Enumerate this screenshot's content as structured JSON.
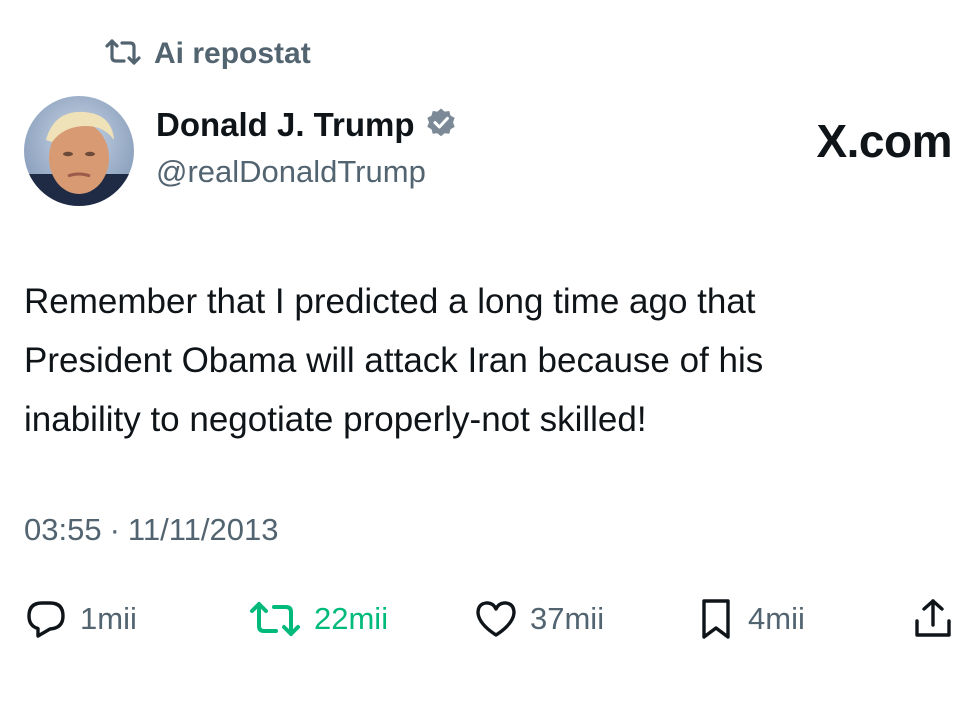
{
  "repost_header": {
    "icon": "repost-icon",
    "label": "Ai repostat"
  },
  "author": {
    "name": "Donald J. Trump",
    "handle": "@realDonaldTrump",
    "verified_icon": "verified-badge-icon",
    "verified_color": "#7b8a96"
  },
  "brand": {
    "label": "X.com"
  },
  "tweet": {
    "lines": [
      "Remember that I predicted a long time ago that",
      "President Obama will attack Iran because of his",
      "inability to negotiate properly-not skilled!"
    ]
  },
  "meta": {
    "time": "03:55",
    "separator": "·",
    "date": "11/11/2013"
  },
  "actions": {
    "reply": {
      "icon": "reply-icon",
      "count": "1mii"
    },
    "retweet": {
      "icon": "retweet-icon",
      "count": "22mii",
      "color": "#00ba7c"
    },
    "like": {
      "icon": "heart-icon",
      "count": "37mii"
    },
    "bookmark": {
      "icon": "bookmark-icon",
      "count": "4mii"
    },
    "share": {
      "icon": "share-icon"
    }
  },
  "colors": {
    "text": "#0f1419",
    "secondary": "#536471",
    "retweet_active": "#00ba7c"
  }
}
